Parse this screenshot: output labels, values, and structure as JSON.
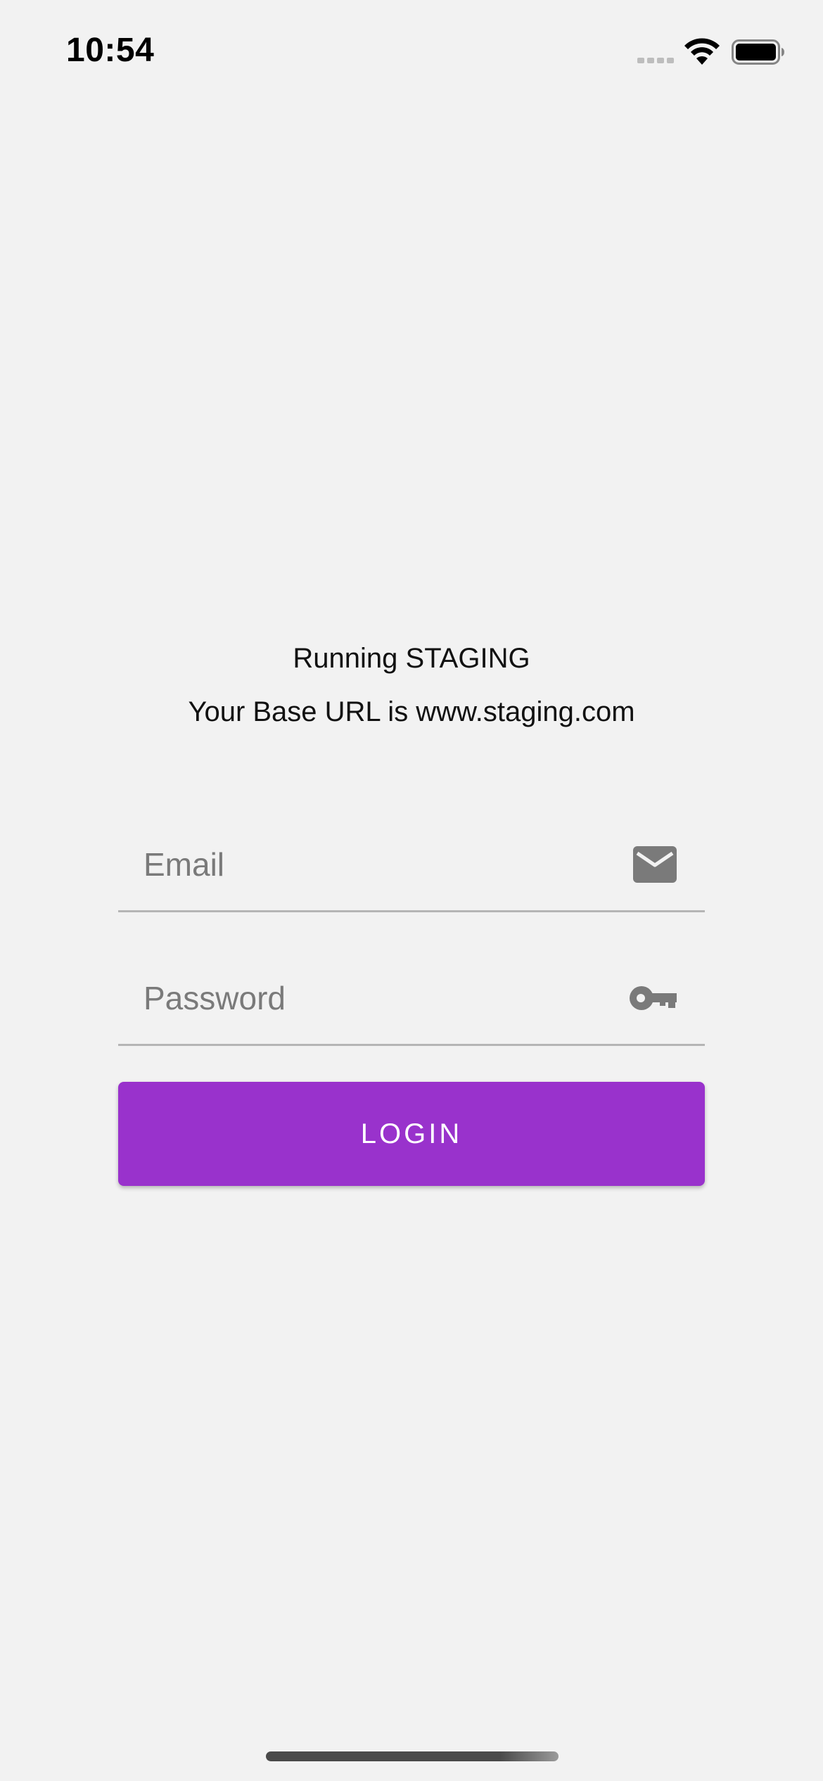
{
  "status_bar": {
    "time": "10:54",
    "icons": [
      "cellular-signal-icon",
      "wifi-icon",
      "battery-icon"
    ]
  },
  "environment": {
    "title": "Running STAGING",
    "base_url_text": "Your Base URL is www.staging.com"
  },
  "form": {
    "email": {
      "placeholder": "Email",
      "value": "",
      "icon": "mail-icon"
    },
    "password": {
      "placeholder": "Password",
      "value": "",
      "icon": "key-icon"
    },
    "login_label": "LOGIN"
  },
  "colors": {
    "background": "#f2f2f2",
    "accent": "#9932cc",
    "button_text": "#ffffff",
    "placeholder": "#7a7a7a",
    "icon": "#7a7a7a",
    "divider": "#b5b5b5"
  }
}
